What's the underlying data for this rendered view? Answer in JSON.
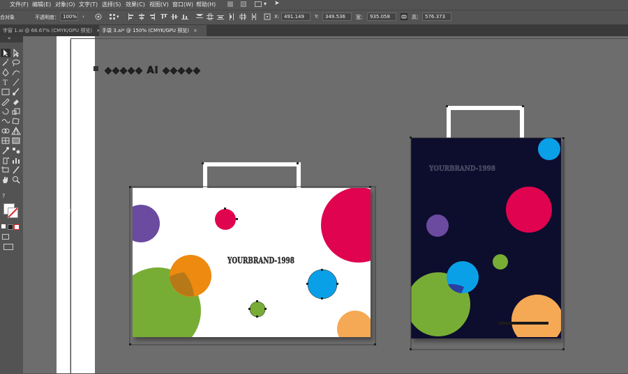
{
  "menu": [
    "文件(F)",
    "编辑(E)",
    "对象(O)",
    "文字(T)",
    "选择(S)",
    "效果(C)",
    "视图(V)",
    "窗口(W)",
    "帮助(H)"
  ],
  "control": {
    "left_label": "合对象",
    "opacity_label": "不透明度：",
    "opacity_value": "100%",
    "x_label": "X:",
    "x_value": "491.149",
    "y_label": "Y:",
    "y_value": "349.536",
    "w_label": "宽：",
    "w_value": "935.058",
    "h_label": "高：",
    "h_value": "576.373"
  },
  "tabs": [
    {
      "label": "字窗 1.ai @ 66.67% (CMYK/GPU 预览)",
      "close": "×",
      "active": false
    },
    {
      "label": "手袋 3.ai* @ 150% (CMYK/GPU 预览)",
      "close": "×",
      "active": true
    }
  ],
  "artwork": {
    "title_text": "◆◆◆◆◆ AI ◆◆◆◆◆",
    "brand_left": "YOURBRAND-1998",
    "brand_right": "YOURBRAND-1998"
  },
  "colors": {
    "pink": "#e0034f",
    "purple": "#6b4ba0",
    "green": "#78ad35",
    "orange": "#ee8a10",
    "blue": "#0aa0e8",
    "peach": "#f5a955",
    "navy": "#0a0f2d"
  }
}
